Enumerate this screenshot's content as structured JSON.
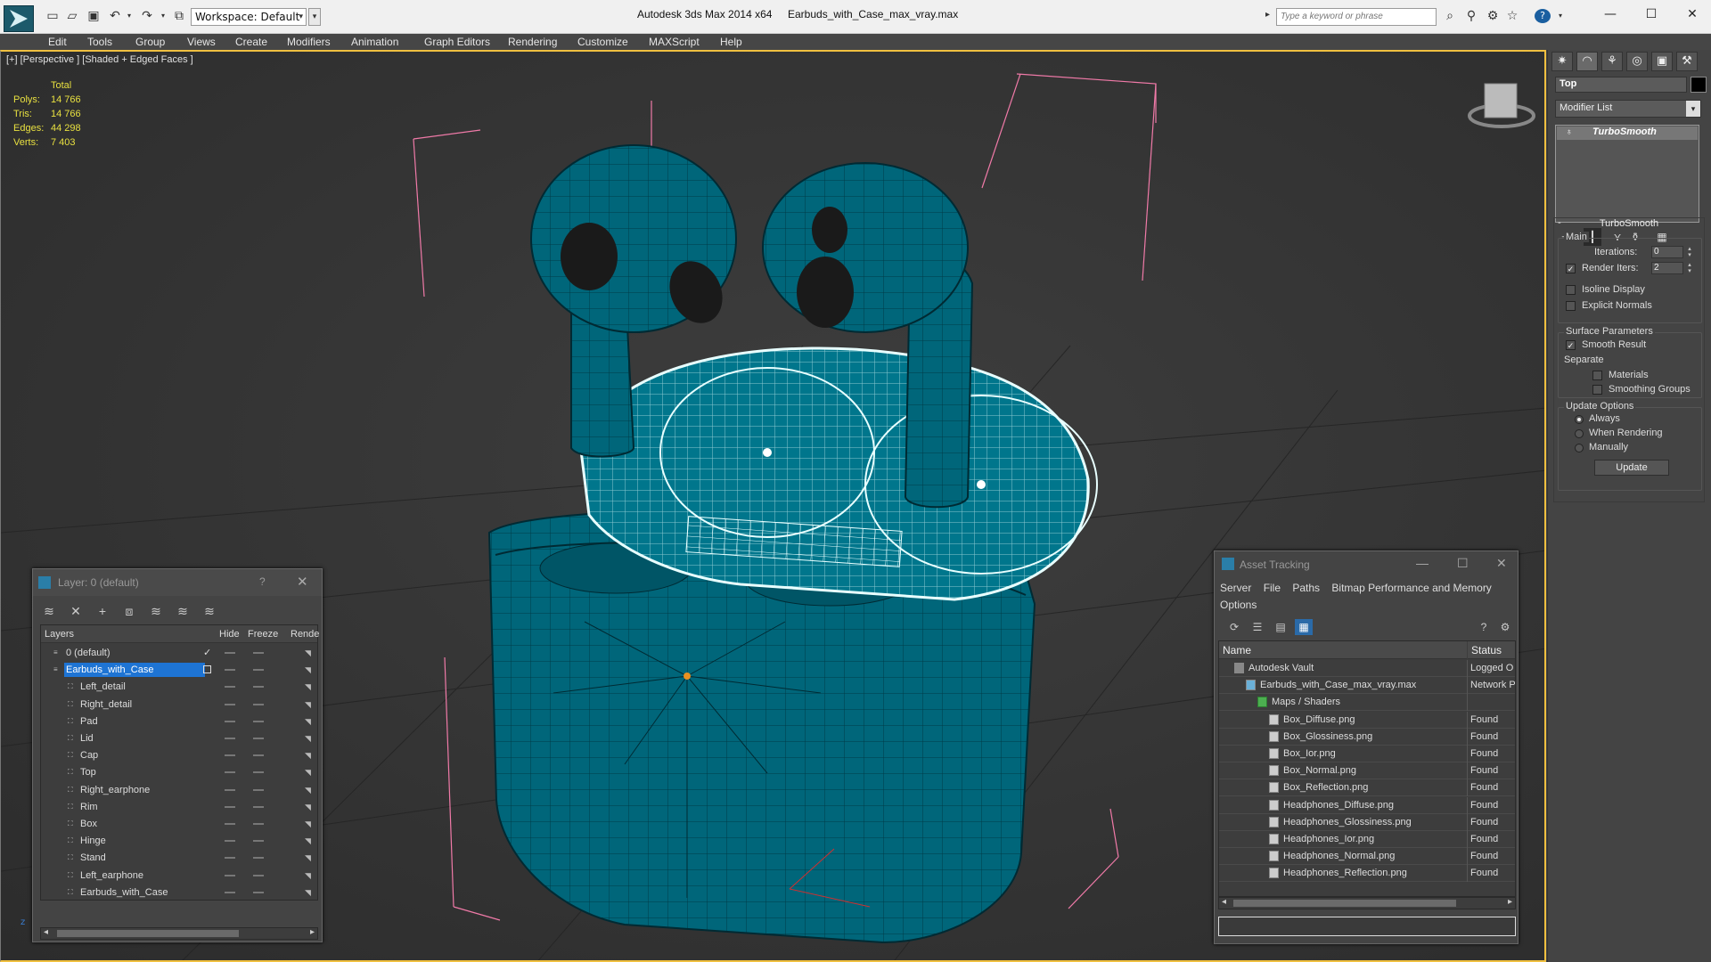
{
  "titlebar": {
    "workspace_label": "Workspace: Default",
    "app_title": "Autodesk 3ds Max  2014 x64",
    "doc_title": "Earbuds_with_Case_max_vray.max",
    "search_placeholder": "Type a keyword or phrase",
    "help_icon": "?"
  },
  "menus": [
    "Edit",
    "Tools",
    "Group",
    "Views",
    "Create",
    "Modifiers",
    "Animation",
    "Graph Editors",
    "Rendering",
    "Customize",
    "MAXScript",
    "Help"
  ],
  "viewport": {
    "label": "[+] [Perspective ] [Shaded + Edged Faces ]",
    "stats_header": "Total",
    "stats": [
      {
        "k": "Polys:",
        "v": "14 766"
      },
      {
        "k": "Tris:",
        "v": "14 766"
      },
      {
        "k": "Edges:",
        "v": "44 298"
      },
      {
        "k": "Verts:",
        "v": "7 403"
      }
    ],
    "model_color": "#00667a",
    "wire_color": "#ffffff",
    "bbox_color": "#f07aa8"
  },
  "command_panel": {
    "tabs": [
      "create-icon",
      "modify-icon",
      "hierarchy-icon",
      "motion-icon",
      "display-icon",
      "utilities-icon"
    ],
    "object_name": "Top",
    "modifier_list": "Modifier List",
    "stack_entry": "TurboSmooth",
    "turbosmooth": {
      "title": "TurboSmooth",
      "main": "Main",
      "iterations_label": "Iterations:",
      "iterations": "0",
      "render_iters_label": "Render Iters:",
      "render_iters": "2",
      "isoline": "Isoline Display",
      "explicit_normals": "Explicit Normals",
      "surface_params": "Surface Parameters",
      "smooth_result": "Smooth Result",
      "separate": "Separate",
      "materials": "Materials",
      "smoothing_groups": "Smoothing Groups",
      "update_options": "Update Options",
      "always": "Always",
      "when_rendering": "When Rendering",
      "manually": "Manually",
      "update_btn": "Update"
    }
  },
  "layers": {
    "title": "Layer: 0 (default)",
    "help": "?",
    "columns": [
      "Layers",
      "Hide",
      "Freeze",
      "Rende"
    ],
    "rows": [
      {
        "name": "0 (default)",
        "indent": 0,
        "type": "layer",
        "check": "✓"
      },
      {
        "name": "Earbuds_with_Case",
        "indent": 0,
        "type": "layer",
        "selected": true
      },
      {
        "name": "Left_detail",
        "indent": 1,
        "type": "obj"
      },
      {
        "name": "Right_detail",
        "indent": 1,
        "type": "obj"
      },
      {
        "name": "Pad",
        "indent": 1,
        "type": "obj"
      },
      {
        "name": "Lid",
        "indent": 1,
        "type": "obj"
      },
      {
        "name": "Cap",
        "indent": 1,
        "type": "obj"
      },
      {
        "name": "Top",
        "indent": 1,
        "type": "obj"
      },
      {
        "name": "Right_earphone",
        "indent": 1,
        "type": "obj"
      },
      {
        "name": "Rim",
        "indent": 1,
        "type": "obj"
      },
      {
        "name": "Box",
        "indent": 1,
        "type": "obj"
      },
      {
        "name": "Hinge",
        "indent": 1,
        "type": "obj"
      },
      {
        "name": "Stand",
        "indent": 1,
        "type": "obj"
      },
      {
        "name": "Left_earphone",
        "indent": 1,
        "type": "obj"
      },
      {
        "name": "Earbuds_with_Case",
        "indent": 1,
        "type": "obj"
      }
    ]
  },
  "assets": {
    "title": "Asset Tracking",
    "menu": [
      "Server",
      "File",
      "Paths",
      "Bitmap Performance and Memory",
      "Options"
    ],
    "columns": [
      "Name",
      "Status"
    ],
    "rows": [
      {
        "name": "Autodesk Vault",
        "indent": 1,
        "status": "Logged O"
      },
      {
        "name": "Earbuds_with_Case_max_vray.max",
        "indent": 2,
        "status": "Network P"
      },
      {
        "name": "Maps / Shaders",
        "indent": 3,
        "status": ""
      },
      {
        "name": "Box_Diffuse.png",
        "indent": 4,
        "status": "Found"
      },
      {
        "name": "Box_Glossiness.png",
        "indent": 4,
        "status": "Found"
      },
      {
        "name": "Box_Ior.png",
        "indent": 4,
        "status": "Found"
      },
      {
        "name": "Box_Normal.png",
        "indent": 4,
        "status": "Found"
      },
      {
        "name": "Box_Reflection.png",
        "indent": 4,
        "status": "Found"
      },
      {
        "name": "Headphones_Diffuse.png",
        "indent": 4,
        "status": "Found"
      },
      {
        "name": "Headphones_Glossiness.png",
        "indent": 4,
        "status": "Found"
      },
      {
        "name": "Headphones_Ior.png",
        "indent": 4,
        "status": "Found"
      },
      {
        "name": "Headphones_Normal.png",
        "indent": 4,
        "status": "Found"
      },
      {
        "name": "Headphones_Reflection.png",
        "indent": 4,
        "status": "Found"
      }
    ]
  }
}
